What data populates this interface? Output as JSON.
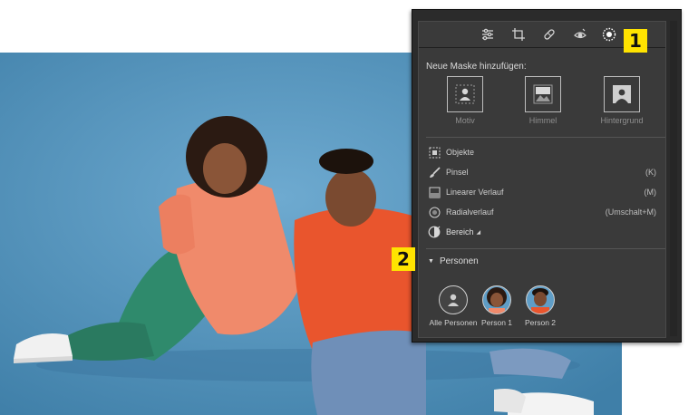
{
  "masking_panel": {
    "toolbar": {
      "icons": [
        "sliders-icon",
        "crop-icon",
        "healing-icon",
        "redeye-icon",
        "masking-icon"
      ]
    },
    "add_mask_title": "Neue Maske hinzufügen:",
    "quick_masks": [
      {
        "label": "Motiv",
        "icon": "subject-icon"
      },
      {
        "label": "Himmel",
        "icon": "sky-icon"
      },
      {
        "label": "Hintergrund",
        "icon": "background-icon"
      }
    ],
    "tools": [
      {
        "label": "Objekte",
        "shortcut": "",
        "icon": "objects-icon"
      },
      {
        "label": "Pinsel",
        "shortcut": "(K)",
        "icon": "brush-icon"
      },
      {
        "label": "Linearer Verlauf",
        "shortcut": "(M)",
        "icon": "linear-gradient-icon"
      },
      {
        "label": "Radialverlauf",
        "shortcut": "(Umschalt+M)",
        "icon": "radial-gradient-icon"
      },
      {
        "label": "Bereich",
        "shortcut": "",
        "icon": "range-icon"
      }
    ],
    "people_section": {
      "title": "Personen",
      "people": [
        {
          "label": "Alle Personen"
        },
        {
          "label": "Person 1"
        },
        {
          "label": "Person 2"
        }
      ]
    }
  },
  "callouts": {
    "first": "1",
    "second": "2"
  },
  "colors": {
    "accent_badge": "#ffe300",
    "panel_bg": "#3a3a3a",
    "photo_bg": "#5f9dc6"
  }
}
